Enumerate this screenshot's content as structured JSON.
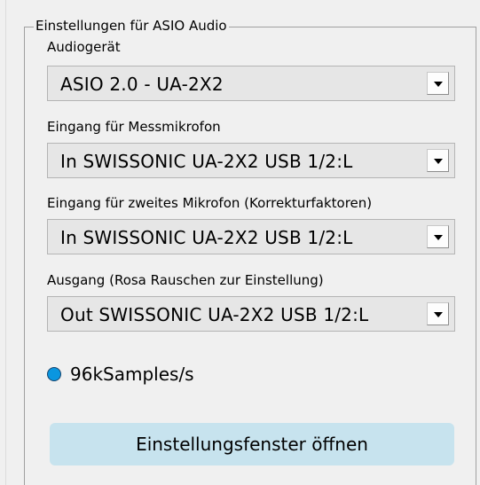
{
  "group": {
    "title": "Einstellungen für ASIO Audio"
  },
  "fields": [
    {
      "label": "Audiogerät",
      "value": "ASIO 2.0 - UA-2X2"
    },
    {
      "label": "Eingang für Messmikrofon",
      "value": "In SWISSONIC UA-2X2 USB 1/2:L"
    },
    {
      "label": "Eingang für zweites Mikrofon (Korrekturfaktoren)",
      "value": "In SWISSONIC UA-2X2 USB 1/2:L"
    },
    {
      "label": "Ausgang (Rosa Rauschen zur Einstellung)",
      "value": "Out SWISSONIC UA-2X2 USB 1/2:L"
    }
  ],
  "sample_rate": {
    "label": "96kSamples/s",
    "selected": true
  },
  "actions": {
    "settings_window_label": "Einstellungsfenster öffnen"
  },
  "icons": {
    "dropdown": "chevron-down-icon",
    "radio": "radio-selected-icon"
  },
  "colors": {
    "background": "#f0f0f0",
    "combo_background": "#e6e6e6",
    "radio_fill": "#0a96e0",
    "button_background": "#c7e3ee"
  }
}
